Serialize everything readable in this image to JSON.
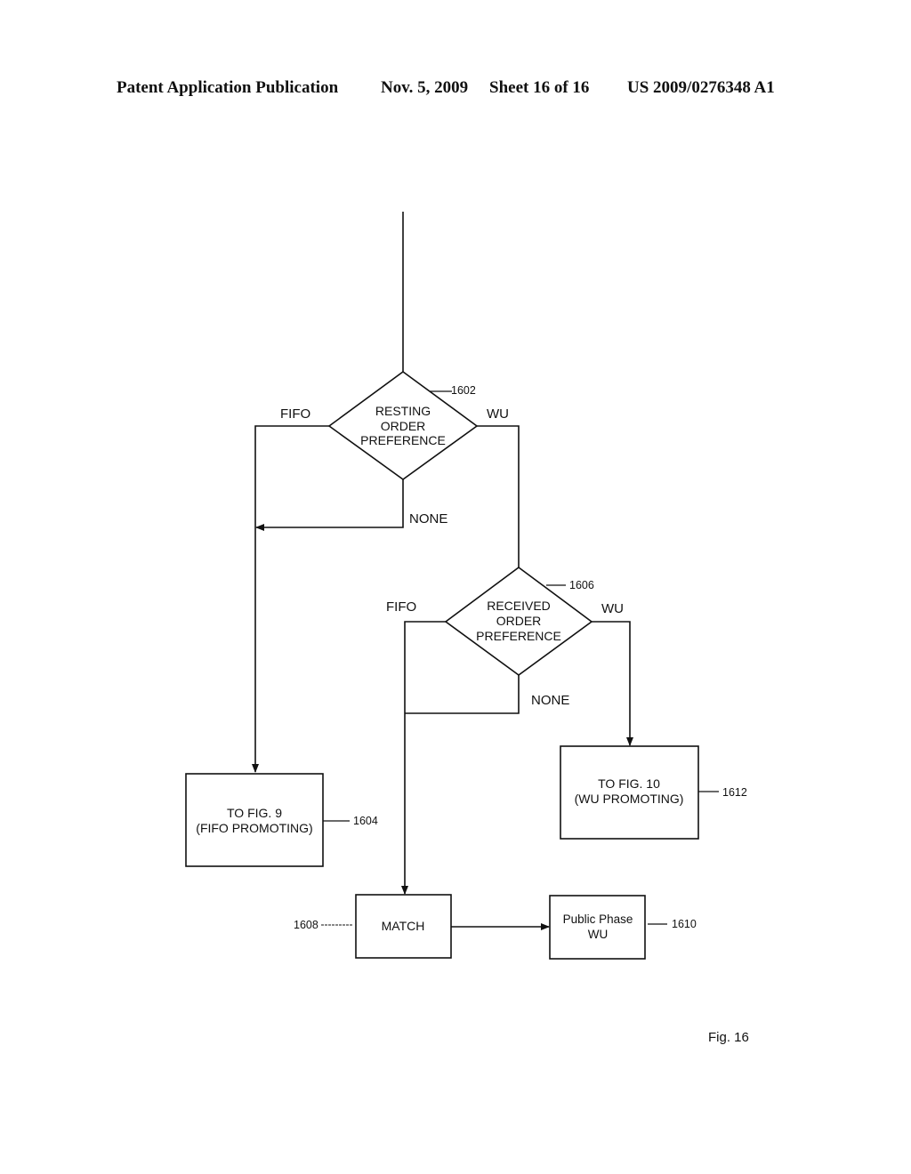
{
  "header": {
    "publication": "Patent Application Publication",
    "date": "Nov. 5, 2009",
    "sheet": "Sheet 16 of 16",
    "number": "US 2009/0276348 A1"
  },
  "figure_label": "Fig. 16",
  "nodes": {
    "d1602": {
      "lines": [
        "RESTING",
        "ORDER",
        "PREFERENCE"
      ],
      "ref": "1602"
    },
    "d1606": {
      "lines": [
        "RECEIVED",
        "ORDER",
        "PREFERENCE"
      ],
      "ref": "1606"
    },
    "b1604": {
      "lines": [
        "TO FIG. 9",
        "(FIFO PROMOTING)"
      ],
      "ref": "1604"
    },
    "b1612": {
      "lines": [
        "TO FIG. 10",
        "(WU PROMOTING)"
      ],
      "ref": "1612"
    },
    "b1608": {
      "lines": [
        "MATCH"
      ],
      "ref": "1608"
    },
    "b1610": {
      "lines": [
        "Public Phase",
        "WU"
      ],
      "ref": "1610"
    }
  },
  "edges": {
    "e1602_fifo": "FIFO",
    "e1602_wu": "WU",
    "e1602_none": "NONE",
    "e1606_fifo": "FIFO",
    "e1606_wu": "WU",
    "e1606_none": "NONE"
  }
}
